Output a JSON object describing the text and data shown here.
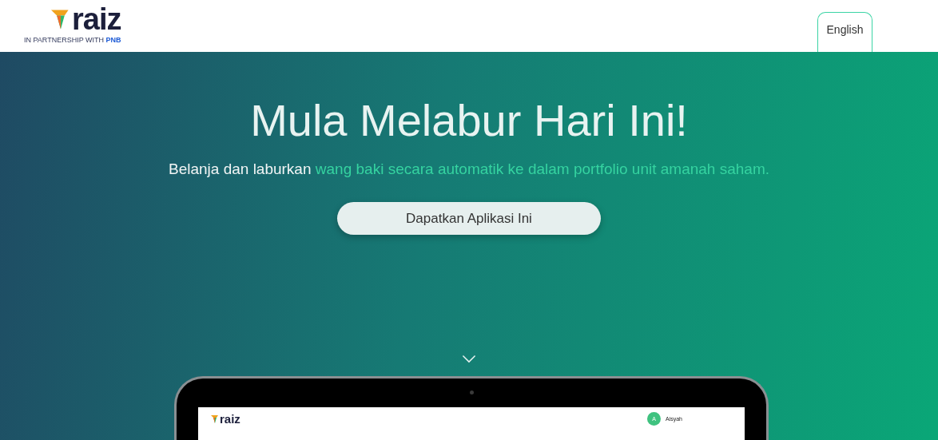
{
  "header": {
    "logo": "raiz",
    "partner_prefix": "IN PARTNERSHIP WITH",
    "partner_name": "PNB",
    "language_button": "English"
  },
  "hero": {
    "title": "Mula Melabur Hari Ini!",
    "subtitle_lead": "Belanja dan laburkan",
    "subtitle_highlight": "wang baki secara automatik ke dalam portfolio unit amanah saham.",
    "cta": "Dapatkan Aplikasi Ini"
  },
  "device": {
    "logo": "raiz",
    "avatar_initial": "A",
    "user_name": "Aisyah"
  }
}
